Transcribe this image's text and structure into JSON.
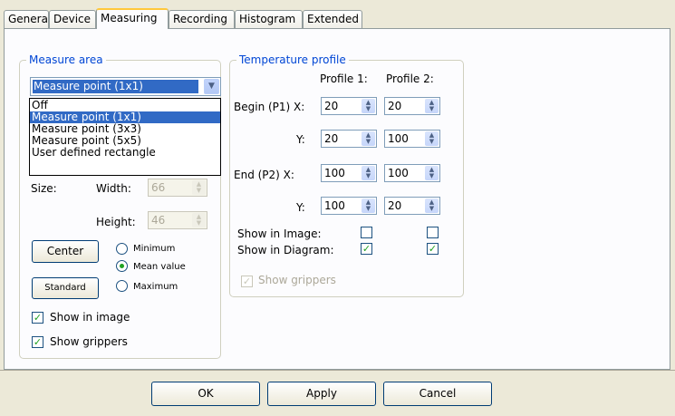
{
  "tabs": [
    "General",
    "Device",
    "Measuring",
    "Recording",
    "Histogram",
    "Extended"
  ],
  "measure_area": {
    "legend": "Measure area",
    "selected": "Measure point (1x1)",
    "options": [
      "Off",
      "Measure point (1x1)",
      "Measure point (3x3)",
      "Measure point (5x5)",
      "User defined rectangle"
    ],
    "size_label": "Size:",
    "width_label": "Width:",
    "width_value": "66",
    "height_label": "Height:",
    "height_value": "46",
    "center_label": "Center",
    "standard_label": "Standard",
    "radio_minimum": "Minimum",
    "radio_mean": "Mean value",
    "radio_maximum": "Maximum",
    "show_in_image": "Show in image",
    "show_grippers": "Show grippers"
  },
  "temperature_profile": {
    "legend": "Temperature profile",
    "profile1": "Profile 1:",
    "profile2": "Profile 2:",
    "begin_x_label": "Begin (P1) X:",
    "begin_y_label": "Y:",
    "end_x_label": "End (P2)  X:",
    "end_y_label": "Y:",
    "begin_x": [
      "20",
      "20"
    ],
    "begin_y": [
      "20",
      "100"
    ],
    "end_x": [
      "100",
      "100"
    ],
    "end_y": [
      "100",
      "20"
    ],
    "show_in_image": "Show in Image:",
    "show_in_diagram": "Show in Diagram:",
    "show_grippers": "Show grippers"
  },
  "footer": {
    "ok": "OK",
    "apply": "Apply",
    "cancel": "Cancel"
  }
}
